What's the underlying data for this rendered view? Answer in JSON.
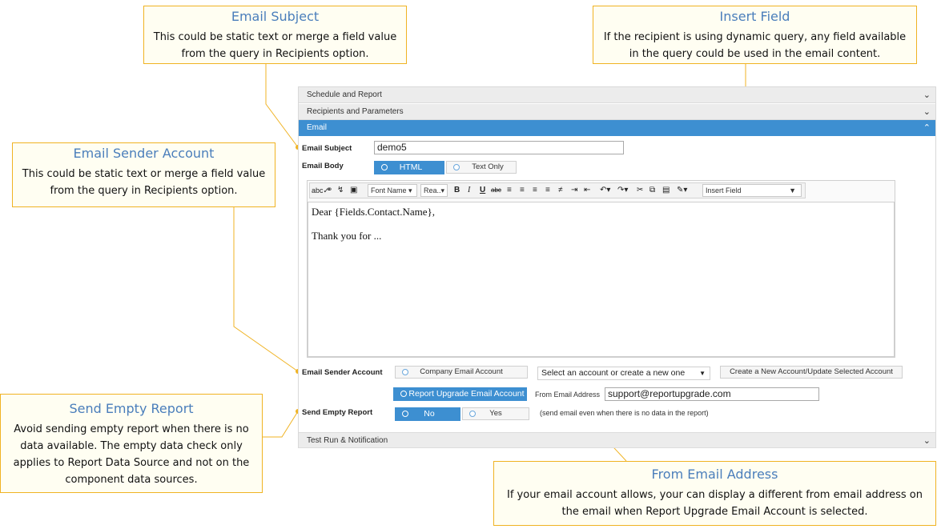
{
  "callouts": {
    "email_subject": {
      "title": "Email Subject",
      "body": "This could be static text or merge  a field value from the query in Recipients option."
    },
    "insert_field": {
      "title": "Insert Field",
      "body": "If the recipient is using dynamic query,  any field available in the query could be used in the email content."
    },
    "email_sender": {
      "title": "Email Sender Account",
      "body": "This could be static text or merge  a field value from the query in Recipients option."
    },
    "send_empty": {
      "title": "Send Empty Report",
      "body": "Avoid sending empty report  when there is no data available. The empty data check only applies to Report Data Source and not on the component  data sources."
    },
    "from_email": {
      "title": "From Email Address",
      "body": "If your email account allows, your can display a different from email address on the email when Report Upgrade Email Account is selected."
    }
  },
  "accordion": {
    "schedule": "Schedule and Report",
    "recipients": "Recipients and Parameters",
    "email": "Email",
    "test_run": "Test Run & Notification"
  },
  "form": {
    "subject_label": "Email Subject",
    "subject_value": "demo5",
    "body_label": "Email Body",
    "body_html": "HTML",
    "body_text": "Text Only",
    "sender_label": "Email Sender Account",
    "company_account": "Company Email Account",
    "report_upgrade_account": "Report Upgrade Email Account",
    "account_select": "Select an account or create a new one",
    "create_account_button": "Create a New Account/Update Selected Account",
    "from_address_label": "From Email Address",
    "from_address_value": "support@reportupgrade.com",
    "send_empty_label": "Send Empty Report",
    "no": "No",
    "yes": "Yes",
    "send_empty_note": "(send email even when there is no data in the report)"
  },
  "editor": {
    "font_name": "Font Name",
    "font_size": "Rea..",
    "insert_field": "Insert Field",
    "line1": "Dear {Fields.Contact.Name},",
    "line2": "Thank you for ..."
  },
  "colors": {
    "accent": "#3d8fd1",
    "callout_border": "#f0b323",
    "callout_title": "#4a7ebb"
  }
}
